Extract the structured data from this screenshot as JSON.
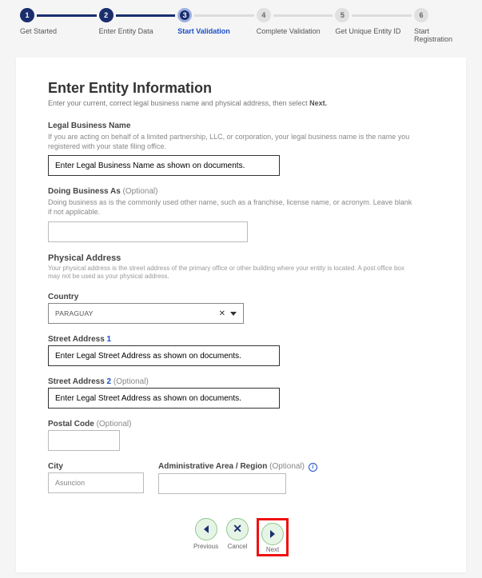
{
  "stepper": {
    "steps": [
      {
        "num": "1",
        "label": "Get Started"
      },
      {
        "num": "2",
        "label": "Enter Entity Data"
      },
      {
        "num": "3",
        "label": "Start Validation"
      },
      {
        "num": "4",
        "label": "Complete Validation"
      },
      {
        "num": "5",
        "label": "Get Unique Entity ID"
      },
      {
        "num": "6",
        "label": "Start Registration"
      }
    ]
  },
  "page": {
    "title": "Enter Entity Information",
    "subtitle_pre": "Enter your current, correct legal business name and physical address, then select ",
    "subtitle_bold": "Next."
  },
  "legal_name": {
    "label": "Legal Business Name",
    "help": "If you are acting on behalf of a limited partnership, LLC, or corporation, your legal business name is the name you registered with your state filing office.",
    "value": "Enter Legal Business Name as shown on documents."
  },
  "dba": {
    "label": "Doing Business As ",
    "optional": "(Optional)",
    "help": "Doing business as is the commonly used other name, such as a franchise, license name, or acronym. Leave blank if not applicable.",
    "value": ""
  },
  "address": {
    "title": "Physical Address",
    "help": "Your physical address is the street address of the primary office or other building where your entity is located. A post office box may not be used as your physical address."
  },
  "country": {
    "label": "Country",
    "value": "PARAGUAY"
  },
  "street1": {
    "label_pre": "Street Address ",
    "label_num": "1",
    "value": "Enter Legal Street Address as shown on documents."
  },
  "street2": {
    "label_pre": "Street Address ",
    "label_num": "2 ",
    "optional": "(Optional)",
    "value": "Enter Legal Street Address as shown on documents."
  },
  "postal": {
    "label": "Postal Code ",
    "optional": "(Optional)",
    "value": ""
  },
  "city": {
    "label": "City",
    "value": "Asuncion"
  },
  "region": {
    "label": "Administrative Area / Region ",
    "optional": "(Optional)",
    "value": ""
  },
  "footer": {
    "previous": "Previous",
    "cancel": "Cancel",
    "next": "Next"
  }
}
